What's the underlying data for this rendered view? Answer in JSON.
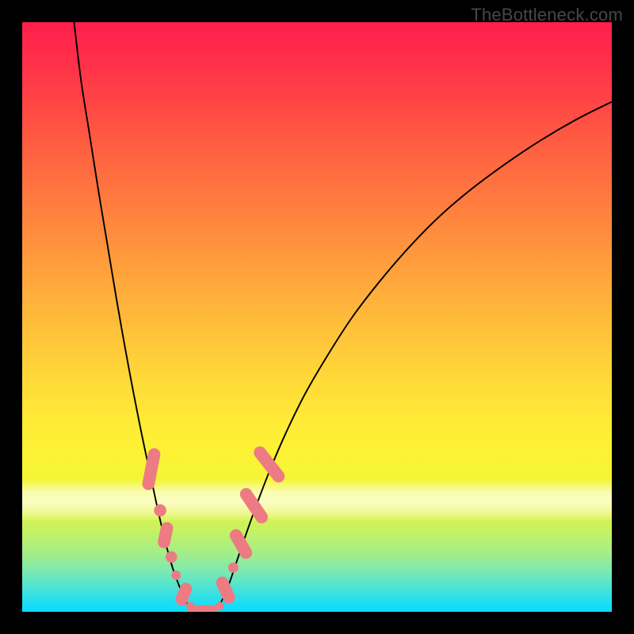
{
  "watermark": "TheBottleneck.com",
  "chart_data": {
    "type": "line",
    "title": "",
    "xlabel": "",
    "ylabel": "",
    "xlim": [
      0,
      1
    ],
    "ylim": [
      0,
      1
    ],
    "note": "Coordinates expressed as fractions of the plot area (left→right for x, top→bottom for y).",
    "series": [
      {
        "name": "left-branch",
        "x": [
          0.088,
          0.1,
          0.115,
          0.13,
          0.145,
          0.16,
          0.175,
          0.19,
          0.205,
          0.22,
          0.233,
          0.245,
          0.255,
          0.264,
          0.272,
          0.279,
          0.286
        ],
        "y": [
          0.0,
          0.1,
          0.195,
          0.29,
          0.38,
          0.47,
          0.555,
          0.635,
          0.71,
          0.78,
          0.84,
          0.89,
          0.925,
          0.95,
          0.97,
          0.985,
          0.994
        ]
      },
      {
        "name": "valley-floor",
        "x": [
          0.286,
          0.295,
          0.305,
          0.315,
          0.324,
          0.332
        ],
        "y": [
          0.994,
          0.998,
          0.999,
          0.999,
          0.998,
          0.994
        ]
      },
      {
        "name": "right-branch",
        "x": [
          0.332,
          0.34,
          0.35,
          0.362,
          0.378,
          0.397,
          0.42,
          0.448,
          0.48,
          0.518,
          0.56,
          0.606,
          0.655,
          0.707,
          0.762,
          0.82,
          0.88,
          0.94,
          1.0
        ],
        "y": [
          0.994,
          0.978,
          0.955,
          0.92,
          0.873,
          0.82,
          0.76,
          0.695,
          0.63,
          0.565,
          0.5,
          0.44,
          0.383,
          0.33,
          0.283,
          0.24,
          0.2,
          0.165,
          0.135
        ]
      }
    ],
    "markers": [
      {
        "series": "left-highlight",
        "shape": "capsule",
        "cx": 0.219,
        "cy": 0.758,
        "len": 0.072,
        "rot": -79
      },
      {
        "series": "left-highlight",
        "shape": "dot",
        "cx": 0.234,
        "cy": 0.828,
        "r": 0.0105
      },
      {
        "series": "left-highlight",
        "shape": "capsule",
        "cx": 0.243,
        "cy": 0.87,
        "len": 0.045,
        "rot": -78
      },
      {
        "series": "left-highlight",
        "shape": "dot",
        "cx": 0.253,
        "cy": 0.907,
        "r": 0.0098
      },
      {
        "series": "left-highlight",
        "shape": "dot",
        "cx": 0.261,
        "cy": 0.938,
        "r": 0.008
      },
      {
        "series": "left-highlight",
        "shape": "capsule",
        "cx": 0.274,
        "cy": 0.97,
        "len": 0.04,
        "rot": -68
      },
      {
        "series": "left-highlight",
        "shape": "dot",
        "cx": 0.285,
        "cy": 0.99,
        "r": 0.007
      },
      {
        "series": "floor-highlight",
        "shape": "capsule",
        "cx": 0.306,
        "cy": 0.999,
        "len": 0.052,
        "rot": 0
      },
      {
        "series": "right-highlight",
        "shape": "dot",
        "cx": 0.335,
        "cy": 0.99,
        "r": 0.007
      },
      {
        "series": "right-highlight",
        "shape": "capsule",
        "cx": 0.345,
        "cy": 0.963,
        "len": 0.048,
        "rot": 66
      },
      {
        "series": "right-highlight",
        "shape": "dot",
        "cx": 0.358,
        "cy": 0.925,
        "r": 0.0086
      },
      {
        "series": "right-highlight",
        "shape": "capsule",
        "cx": 0.371,
        "cy": 0.885,
        "len": 0.055,
        "rot": 60
      },
      {
        "series": "right-highlight",
        "shape": "capsule",
        "cx": 0.393,
        "cy": 0.82,
        "len": 0.068,
        "rot": 56
      },
      {
        "series": "right-highlight",
        "shape": "capsule",
        "cx": 0.419,
        "cy": 0.75,
        "len": 0.072,
        "rot": 52
      }
    ],
    "marker_color": "#ed7b84"
  }
}
